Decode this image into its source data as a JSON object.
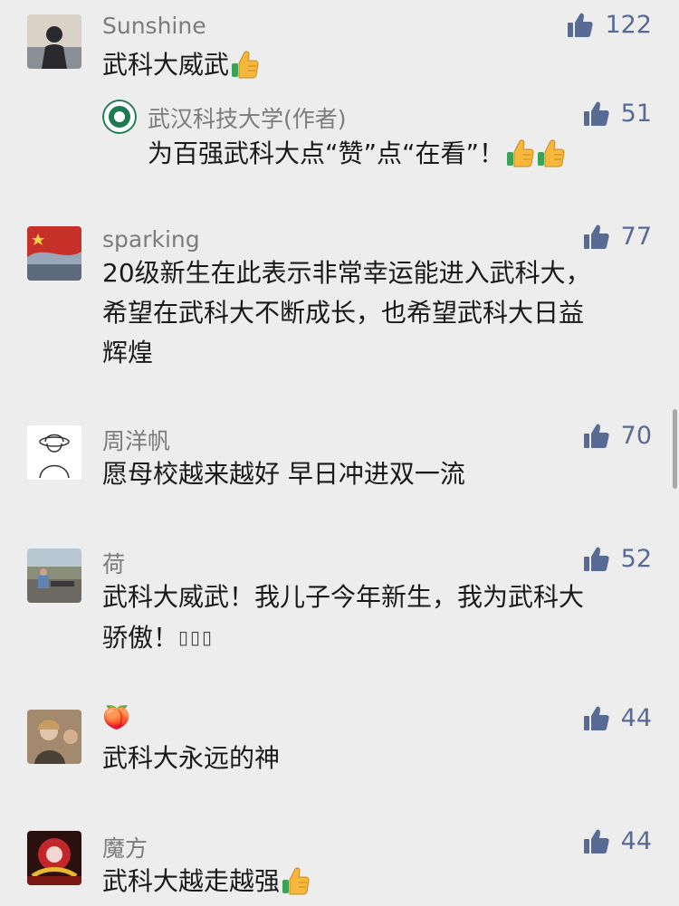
{
  "comments": [
    {
      "name": "Sunshine",
      "likes": "122",
      "text": "武科大威武",
      "reply": {
        "name": "武汉科技大学(作者)",
        "likes": "51",
        "text": "为百强武科大点“赞”点“在看”！"
      }
    },
    {
      "name": "sparking",
      "likes": "77",
      "lines": [
        "20级新生在此表示非常幸运能进入武科大，",
        "希望在武科大不断成长，也希望武科大日益",
        "辉煌"
      ]
    },
    {
      "name": "周洋帆",
      "likes": "70",
      "text": "愿母校越来越好 早日冲进双一流"
    },
    {
      "name": "荷",
      "likes": "52",
      "lines": [
        "武科大威武！我儿子今年新生，我为武科大",
        "骄傲！"
      ],
      "trailing": "▯▯▯"
    },
    {
      "name": "🍑",
      "likes": "44",
      "text": "武科大永远的神"
    },
    {
      "name": "魔方",
      "likes": "44",
      "text": "武科大越走越强"
    }
  ],
  "colors": {
    "like": "#576b95",
    "name": "#7c7c7c",
    "text": "#1a1a1a",
    "background": "#ededed"
  },
  "icons": {
    "like": "thumbs-up-icon",
    "emoji": "thumbs-up-emoji"
  }
}
